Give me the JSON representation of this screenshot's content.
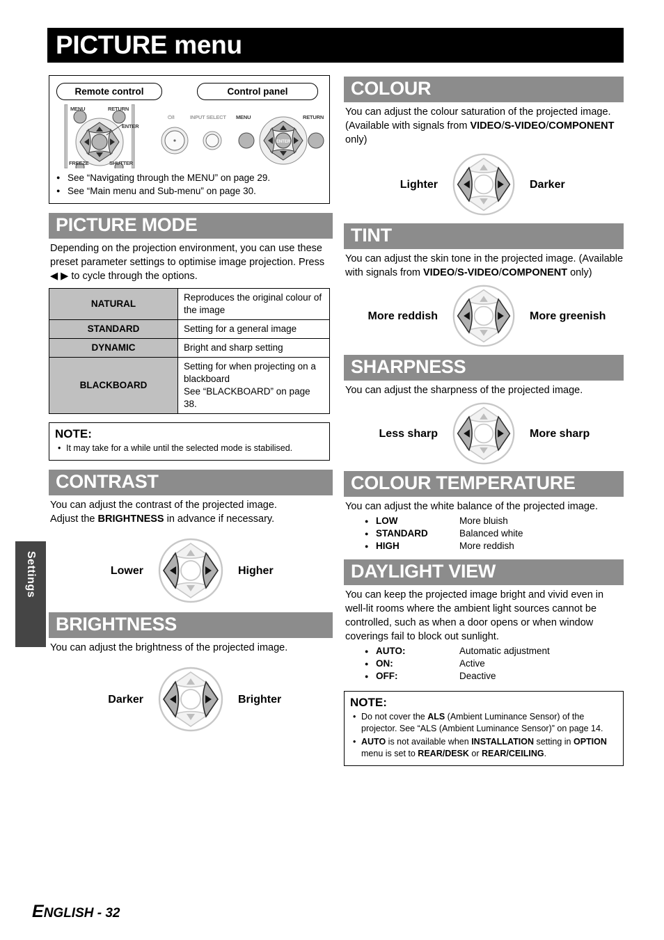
{
  "page_title": "PICTURE menu",
  "side_tab": "Settings",
  "footer": {
    "lang": "ENGLISH",
    "sep": " - ",
    "page": "32"
  },
  "hardware": {
    "remote_tab": "Remote control",
    "panel_tab": "Control panel",
    "remote_labels": [
      "MENU",
      "RETURN",
      "ENTER",
      "FREEZE",
      "SHUTTER"
    ],
    "panel_labels": [
      "⏻/I",
      "INPUT SELECT",
      "MENU",
      "RETURN",
      "ENTER"
    ],
    "references": [
      "See “Navigating through the MENU” on page 29.",
      "See “Main menu and Sub-menu” on page 30."
    ]
  },
  "picture_mode": {
    "heading": "PICTURE MODE",
    "intro": "Depending on the projection environment, you can use these preset parameter settings to optimise image projection. Press ◀ ▶ to cycle through the options.",
    "rows": [
      {
        "mode": "NATURAL",
        "desc": "Reproduces the original colour of the image"
      },
      {
        "mode": "STANDARD",
        "desc": "Setting for a general image"
      },
      {
        "mode": "DYNAMIC",
        "desc": "Bright and sharp setting"
      },
      {
        "mode": "BLACKBOARD",
        "desc": "Setting for when projecting on a blackboard\nSee “BLACKBOARD” on page 38."
      }
    ],
    "note_title": "NOTE:",
    "note_items": [
      "It may take for a while until the selected mode is stabilised."
    ]
  },
  "contrast": {
    "heading": "CONTRAST",
    "body_1": "You can adjust the contrast of the projected image.",
    "body_2_pre": "Adjust the ",
    "body_2_bold": "BRIGHTNESS",
    "body_2_post": " in advance if necessary.",
    "left_label": "Lower",
    "right_label": "Higher"
  },
  "brightness": {
    "heading": "BRIGHTNESS",
    "body": "You can adjust the brightness of the projected image.",
    "left_label": "Darker",
    "right_label": "Brighter"
  },
  "colour": {
    "heading": "COLOUR",
    "body_pre": "You can adjust the colour saturation of the projected image. (Available with signals from ",
    "body_bold_1": "VIDEO",
    "body_sep_1": "/",
    "body_bold_2": "S-VIDEO",
    "body_sep_2": "/",
    "body_bold_3": "COMPONENT",
    "body_post": " only)",
    "left_label": "Lighter",
    "right_label": "Darker"
  },
  "tint": {
    "heading": "TINT",
    "body_pre": "You can adjust the skin tone in the projected image. (Available with signals from ",
    "body_bold_1": "VIDEO",
    "body_sep_1": "/",
    "body_bold_2": "S-VIDEO",
    "body_sep_2": "/",
    "body_bold_3": "COMPONENT",
    "body_post": " only)",
    "left_label": "More reddish",
    "right_label": "More greenish"
  },
  "sharpness": {
    "heading": "SHARPNESS",
    "body": "You can adjust the sharpness of the projected image.",
    "left_label": "Less sharp",
    "right_label": "More sharp"
  },
  "colour_temperature": {
    "heading": "COLOUR TEMPERATURE",
    "body": "You can adjust the white balance of the projected image.",
    "options": [
      {
        "term": "LOW",
        "desc": "More bluish"
      },
      {
        "term": "STANDARD",
        "desc": "Balanced white"
      },
      {
        "term": "HIGH",
        "desc": "More reddish"
      }
    ]
  },
  "daylight_view": {
    "heading": "DAYLIGHT VIEW",
    "body": "You can keep the projected image bright and vivid even in well-lit rooms where the ambient light sources cannot be controlled, such as when a door opens or when window coverings fail to block out sunlight.",
    "options": [
      {
        "term": "AUTO:",
        "desc": "Automatic adjustment"
      },
      {
        "term": "ON:",
        "desc": "Active"
      },
      {
        "term": "OFF:",
        "desc": "Deactive"
      }
    ],
    "note_title": "NOTE:",
    "note_1_a": "Do not cover the ",
    "note_1_b": "ALS",
    "note_1_c": " (Ambient Luminance Sensor) of the projector. See “ALS (Ambient Luminance Sensor)” on page 14.",
    "note_2_a": "AUTO",
    "note_2_b": " is not available when ",
    "note_2_c": "INSTALLATION",
    "note_2_d": " setting in ",
    "note_2_e": "OPTION",
    "note_2_f": " menu is set to ",
    "note_2_g": "REAR/DESK",
    "note_2_h": " or ",
    "note_2_i": "REAR/CEILING",
    "note_2_j": "."
  },
  "colors": {
    "title_bar": "#000000",
    "section_header": "#8c8c8c",
    "table_key_cell": "#c0c0c0",
    "side_tab": "#454545",
    "dpad_active": "#b0b0b0",
    "dpad_idle": "#ededed"
  }
}
